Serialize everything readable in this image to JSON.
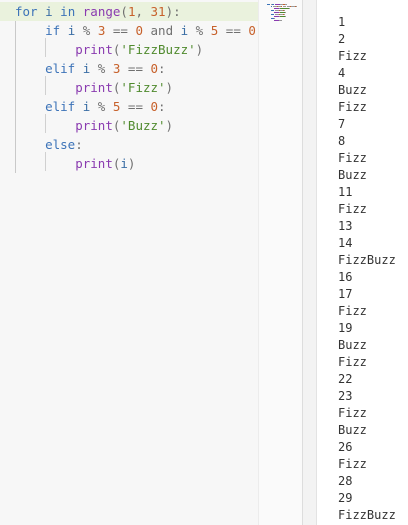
{
  "editor": {
    "lines": [
      [
        {
          "t": "for",
          "c": "kw"
        },
        {
          "t": " "
        },
        {
          "t": "i",
          "c": "id"
        },
        {
          "t": " "
        },
        {
          "t": "in",
          "c": "kw"
        },
        {
          "t": " "
        },
        {
          "t": "range",
          "c": "fn"
        },
        {
          "t": "(",
          "c": "op"
        },
        {
          "t": "1",
          "c": "num"
        },
        {
          "t": ", ",
          "c": "op"
        },
        {
          "t": "31",
          "c": "num"
        },
        {
          "t": "):",
          "c": "op"
        }
      ],
      [
        {
          "t": "    "
        },
        {
          "t": "if",
          "c": "kw"
        },
        {
          "t": " "
        },
        {
          "t": "i",
          "c": "id"
        },
        {
          "t": " % ",
          "c": "op"
        },
        {
          "t": "3",
          "c": "num"
        },
        {
          "t": " == ",
          "c": "op"
        },
        {
          "t": "0",
          "c": "num"
        },
        {
          "t": " "
        },
        {
          "t": "and",
          "c": "op"
        },
        {
          "t": " "
        },
        {
          "t": "i",
          "c": "id"
        },
        {
          "t": " % ",
          "c": "op"
        },
        {
          "t": "5",
          "c": "num"
        },
        {
          "t": " == ",
          "c": "op"
        },
        {
          "t": "0",
          "c": "num"
        },
        {
          "t": ":",
          "c": "op"
        }
      ],
      [
        {
          "t": "        "
        },
        {
          "t": "print",
          "c": "fn"
        },
        {
          "t": "(",
          "c": "op"
        },
        {
          "t": "'FizzBuzz'",
          "c": "str"
        },
        {
          "t": ")",
          "c": "op"
        }
      ],
      [
        {
          "t": "    "
        },
        {
          "t": "elif",
          "c": "kw"
        },
        {
          "t": " "
        },
        {
          "t": "i",
          "c": "id"
        },
        {
          "t": " % ",
          "c": "op"
        },
        {
          "t": "3",
          "c": "num"
        },
        {
          "t": " == ",
          "c": "op"
        },
        {
          "t": "0",
          "c": "num"
        },
        {
          "t": ":",
          "c": "op"
        }
      ],
      [
        {
          "t": "        "
        },
        {
          "t": "print",
          "c": "fn"
        },
        {
          "t": "(",
          "c": "op"
        },
        {
          "t": "'Fizz'",
          "c": "str"
        },
        {
          "t": ")",
          "c": "op"
        }
      ],
      [
        {
          "t": "    "
        },
        {
          "t": "elif",
          "c": "kw"
        },
        {
          "t": " "
        },
        {
          "t": "i",
          "c": "id"
        },
        {
          "t": " % ",
          "c": "op"
        },
        {
          "t": "5",
          "c": "num"
        },
        {
          "t": " == ",
          "c": "op"
        },
        {
          "t": "0",
          "c": "num"
        },
        {
          "t": ":",
          "c": "op"
        }
      ],
      [
        {
          "t": "        "
        },
        {
          "t": "print",
          "c": "fn"
        },
        {
          "t": "(",
          "c": "op"
        },
        {
          "t": "'Buzz'",
          "c": "str"
        },
        {
          "t": ")",
          "c": "op"
        }
      ],
      [
        {
          "t": "    "
        },
        {
          "t": "else",
          "c": "kw"
        },
        {
          "t": ":",
          "c": "op"
        }
      ],
      [
        {
          "t": "        "
        },
        {
          "t": "print",
          "c": "fn"
        },
        {
          "t": "(",
          "c": "op"
        },
        {
          "t": "i",
          "c": "id"
        },
        {
          "t": ")",
          "c": "op"
        }
      ]
    ]
  },
  "output": {
    "lines": [
      "1",
      "2",
      "Fizz",
      "4",
      "Buzz",
      "Fizz",
      "7",
      "8",
      "Fizz",
      "Buzz",
      "11",
      "Fizz",
      "13",
      "14",
      "FizzBuzz",
      "16",
      "17",
      "Fizz",
      "19",
      "Buzz",
      "Fizz",
      "22",
      "23",
      "Fizz",
      "Buzz",
      "26",
      "Fizz",
      "28",
      "29",
      "FizzBuzz"
    ]
  },
  "colors": {
    "keyword": "#3c73b8",
    "function": "#8a3bb0",
    "number": "#c7612b",
    "string": "#4f8a2d",
    "active_line": "#eaf2dd"
  }
}
